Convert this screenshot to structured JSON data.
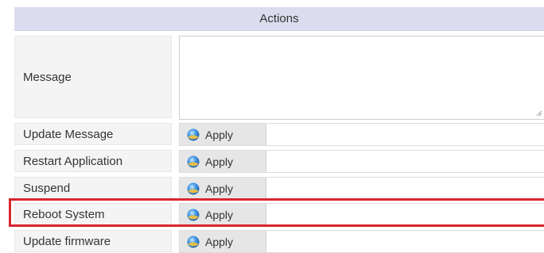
{
  "table": {
    "header": "Actions",
    "message_label": "Message",
    "message_value": "",
    "rows": [
      {
        "label": "Update Message",
        "button": "Apply"
      },
      {
        "label": "Restart Application",
        "button": "Apply"
      },
      {
        "label": "Suspend",
        "button": "Apply"
      },
      {
        "label": "Reboot System",
        "button": "Apply"
      },
      {
        "label": "Update firmware",
        "button": "Apply"
      }
    ]
  },
  "icons": {
    "apply_icon": "globe-icon",
    "resize_grip": "resize-grip-icon"
  },
  "colors": {
    "header_bg": "#dcdcef",
    "label_bg": "#f4f4f4",
    "button_bg": "#e6e6e6",
    "highlight": "#d9262f",
    "icon_blue": "#3a8ee6"
  },
  "highlighted_row": "Reboot System"
}
